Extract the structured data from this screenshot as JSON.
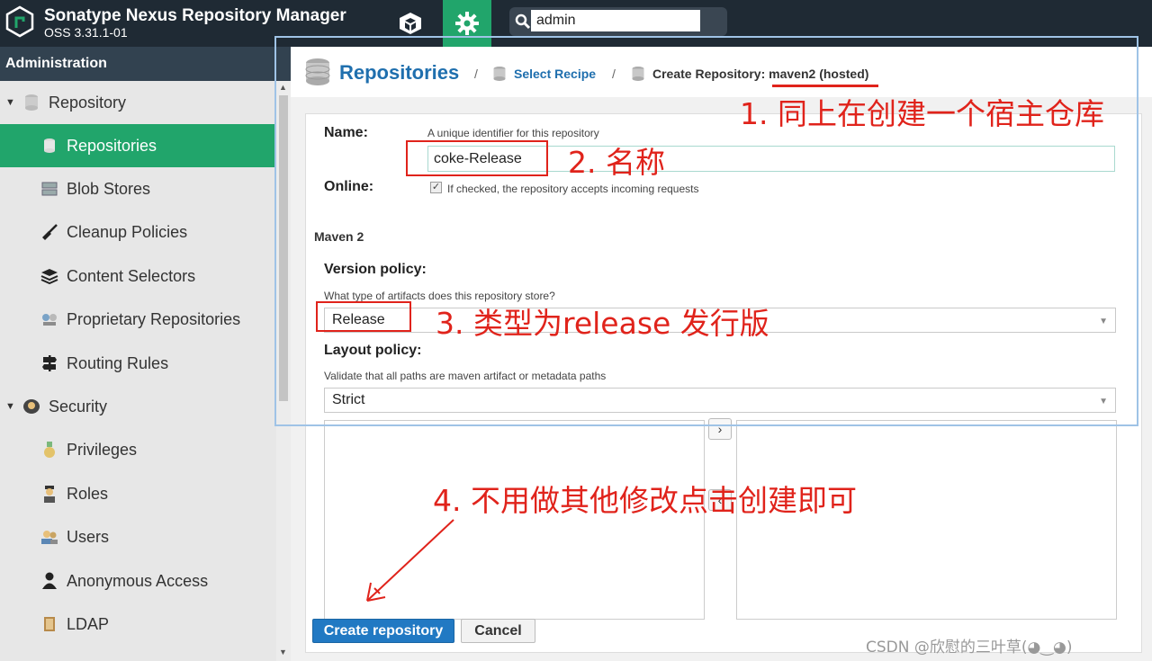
{
  "header": {
    "title": "Sonatype Nexus Repository Manager",
    "version": "OSS 3.31.1-01",
    "search_value": "admin"
  },
  "sidebar": {
    "title": "Administration",
    "items": [
      {
        "label": "Repository",
        "icon": "database-icon",
        "group": true
      },
      {
        "label": "Repositories",
        "icon": "database-icon",
        "active": true
      },
      {
        "label": "Blob Stores",
        "icon": "server-icon"
      },
      {
        "label": "Cleanup Policies",
        "icon": "broom-icon"
      },
      {
        "label": "Content Selectors",
        "icon": "layers-icon"
      },
      {
        "label": "Proprietary Repositories",
        "icon": "proprietary-icon"
      },
      {
        "label": "Routing Rules",
        "icon": "signpost-icon"
      },
      {
        "label": "Security",
        "icon": "security-icon",
        "group": true
      },
      {
        "label": "Privileges",
        "icon": "medal-icon"
      },
      {
        "label": "Roles",
        "icon": "role-icon"
      },
      {
        "label": "Users",
        "icon": "users-icon"
      },
      {
        "label": "Anonymous Access",
        "icon": "person-icon"
      },
      {
        "label": "LDAP",
        "icon": "book-icon"
      }
    ]
  },
  "breadcrumb": {
    "title": "Repositories",
    "sep": "/",
    "recipe": "Select Recipe",
    "current_prefix": "Create Repository:",
    "current_value": "maven2 (hosted)"
  },
  "form": {
    "name_label": "Name:",
    "name_hint": "A unique identifier for this repository",
    "name_value": "coke-Release",
    "online_label": "Online:",
    "online_hint": "If checked, the repository accepts incoming requests",
    "online_checked": true,
    "section_maven": "Maven 2",
    "version_label": "Version policy:",
    "version_hint": "What type of artifacts does this repository store?",
    "version_value": "Release",
    "layout_label": "Layout policy:",
    "layout_hint": "Validate that all paths are maven artifact or metadata paths",
    "layout_value": "Strict"
  },
  "buttons": {
    "create": "Create repository",
    "cancel": "Cancel"
  },
  "annotations": {
    "a1": "1. 同上在创建一个宿主仓库",
    "a2": "2. 名称",
    "a3": "3. 类型为release 发行版",
    "a4": "4. 不用做其他修改点击创建即可"
  },
  "watermark": "CSDN @欣慰的三叶草(◕‿◕)",
  "colors": {
    "header": "#1f2a34",
    "accent": "#21a56b",
    "link": "#1f6fae",
    "annotation": "#e0231b"
  }
}
